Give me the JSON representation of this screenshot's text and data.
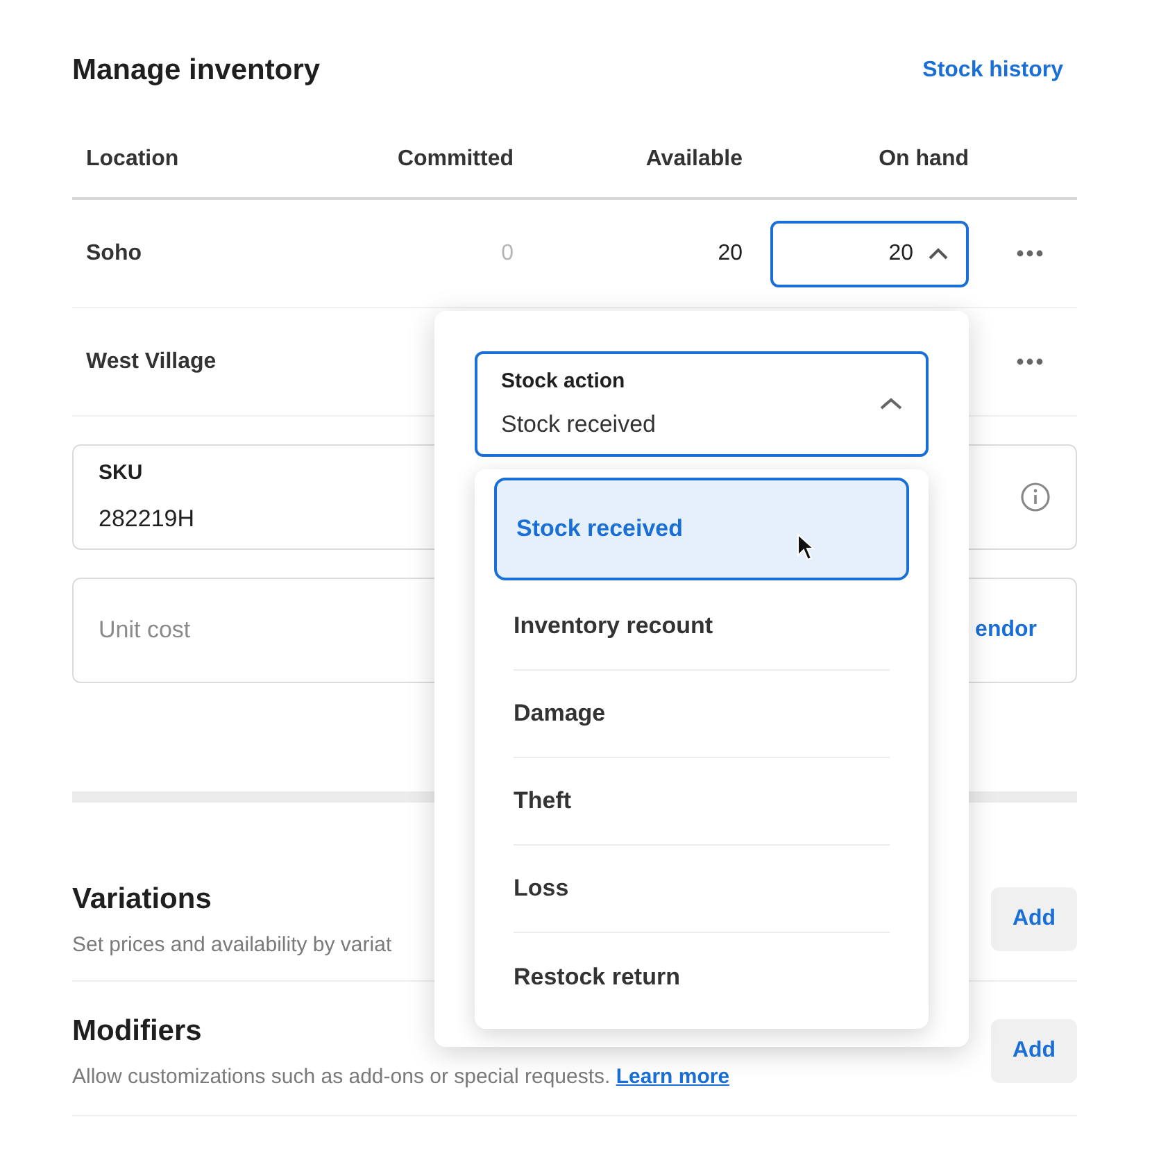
{
  "header": {
    "title": "Manage inventory",
    "link": "Stock history"
  },
  "table": {
    "columns": [
      "Location",
      "Committed",
      "Available",
      "On hand"
    ],
    "rows": [
      {
        "location": "Soho",
        "committed": "0",
        "available": "20",
        "on_hand": "20"
      },
      {
        "location": "West Village"
      }
    ]
  },
  "sku": {
    "label": "SKU",
    "value": "282219H"
  },
  "unit_cost": {
    "placeholder": "Unit cost",
    "link": "endor"
  },
  "sections": [
    {
      "title": "Variations",
      "description": "Set prices and availability by variat",
      "button": "Add"
    },
    {
      "title": "Modifiers",
      "description": "Allow customizations such as add-ons or special requests.",
      "link": "Learn more",
      "button": "Add"
    }
  ],
  "stock_action": {
    "label": "Stock action",
    "value": "Stock received",
    "expanded": true,
    "options": [
      {
        "label": "Stock received",
        "selected": true
      },
      {
        "label": "Inventory recount",
        "selected": false
      },
      {
        "label": "Damage",
        "selected": false
      },
      {
        "label": "Theft",
        "selected": false
      },
      {
        "label": "Loss",
        "selected": false
      },
      {
        "label": "Restock return",
        "selected": false
      }
    ]
  }
}
